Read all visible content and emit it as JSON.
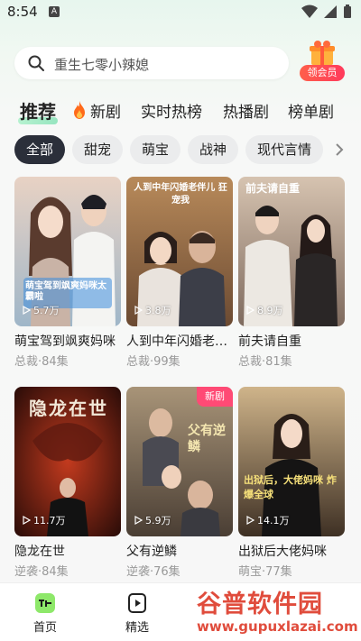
{
  "status_bar": {
    "time": "8:54",
    "notif_letter": "A"
  },
  "search": {
    "placeholder": "重生七零小辣媳"
  },
  "vip": {
    "label": "领会员"
  },
  "category_tabs": [
    "推荐",
    "新剧",
    "实时热榜",
    "热播剧",
    "榜单剧"
  ],
  "genre_chips": [
    "全部",
    "甜宠",
    "萌宝",
    "战神",
    "现代言情"
  ],
  "cards": [
    {
      "title": "萌宝驾到飒爽妈咪",
      "meta": "总裁·84集",
      "views": "5.7万",
      "poster_text": "萌宝驾到飒爽妈咪太霸啦"
    },
    {
      "title": "人到中年闪婚老伴儿",
      "meta": "总裁·99集",
      "views": "3.8万",
      "poster_text": "人到中年闪婚老伴儿 狂宠我"
    },
    {
      "title": "前夫请自重",
      "meta": "总裁·81集",
      "views": "8.9万",
      "poster_text": "前夫请自重"
    },
    {
      "title": "隐龙在世",
      "meta": "逆袭·84集",
      "views": "11.7万",
      "poster_text": "隐龙在世"
    },
    {
      "title": "父有逆鳞",
      "meta": "逆袭·76集",
      "views": "5.9万",
      "poster_text": "父有逆鳞",
      "badge": "新剧"
    },
    {
      "title": "出狱后大佬妈咪",
      "meta": "萌宝·77集",
      "views": "14.1万",
      "poster_text": "出狱后，大佬妈咪 炸爆全球"
    }
  ],
  "bottom_nav": [
    {
      "label": "首页",
      "icon": "home-logo-icon"
    },
    {
      "label": "精选",
      "icon": "play-card-icon"
    }
  ],
  "watermark": {
    "main": "谷普软件园",
    "url": "www.gupuxlazai.com"
  },
  "colors": {
    "accent_green": "#7fe0b2",
    "vip_red": "#ff3a5c",
    "new_badge": "#ff4a75",
    "chip_active": "#2b2f3a"
  }
}
